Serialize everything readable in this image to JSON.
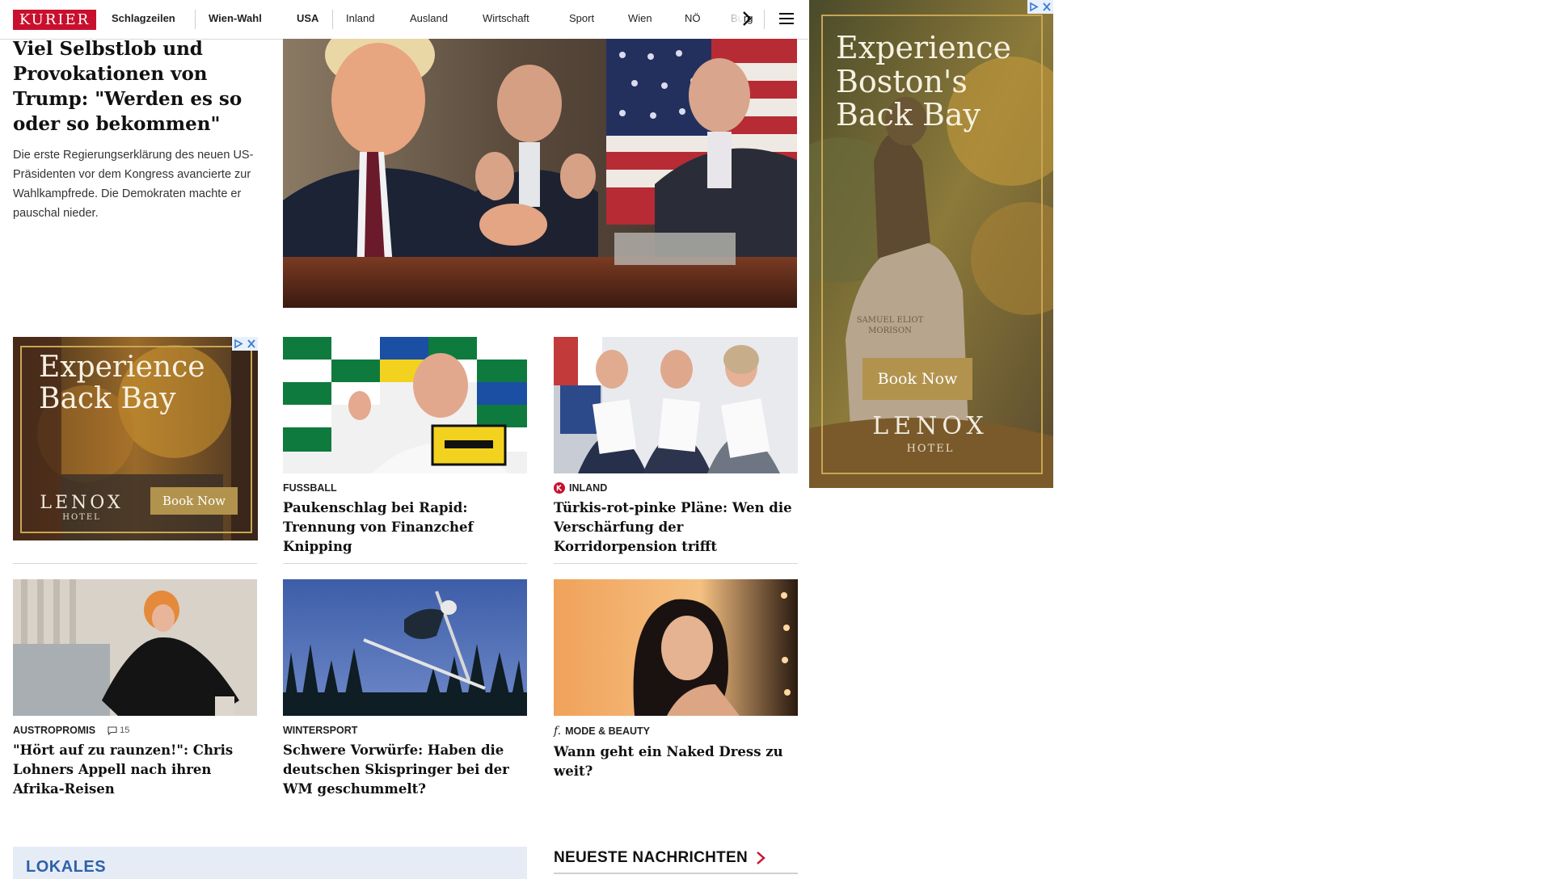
{
  "nav": {
    "logo": "KURIER",
    "items": [
      "Schlagzeilen",
      "Wien-Wahl",
      "USA",
      "Inland",
      "Ausland",
      "Wirtschaft",
      "Sport",
      "Wien",
      "NÖ",
      "Burg"
    ]
  },
  "lead": {
    "title": "Viel Selbstlob und Provokationen von Trump: \"Werden es so oder so bekommen\"",
    "teaser": "Die erste Regierungserklärung des neuen US-Präsidenten vor dem Kongress avancierte zur Wahlkampfrede. Die Demokraten machte er pauschal nieder."
  },
  "ads": {
    "right": {
      "headline_line1": "Experience",
      "headline_line2": "Boston's",
      "headline_line3": "Back Bay",
      "cta": "Book Now",
      "brand": "LENOX",
      "brand_sub": "HOTEL",
      "plaque": "SAMUEL ELIOT MORISON"
    },
    "inline": {
      "headline_line1": "Experience",
      "headline_line2": "Back Bay",
      "cta": "Book Now",
      "brand": "LENOX",
      "brand_sub": "HOTEL"
    }
  },
  "cards": [
    {
      "kicker": "FUSSBALL",
      "title": "Paukenschlag bei Rapid: Trennung von Finanzchef Knipping"
    },
    {
      "kicker": "INLAND",
      "title": "Türkis-rot-pinke Pläne: Wen die Verschärfung der Korridorpension trifft"
    },
    {
      "kicker": "AUSTROPROMIS",
      "comments": "15",
      "title": "\"Hört auf zu raunzen!\": Chris Lohners Appell nach ihren Afrika-Reisen"
    },
    {
      "kicker": "WINTERSPORT",
      "title": "Schwere Vorwürfe: Haben die deutschen Skispringer bei der WM geschummelt?"
    },
    {
      "kicker": "MODE & BEAUTY",
      "title": "Wann geht ein Naked Dress zu weit?"
    }
  ],
  "sections": {
    "lokales": "LOKALES",
    "neueste": "NEUESTE NACHRICHTEN"
  },
  "colors": {
    "brand_red": "#c8102e",
    "lokales_blue": "#2f61a8",
    "ad_gold": "#b2934d"
  }
}
